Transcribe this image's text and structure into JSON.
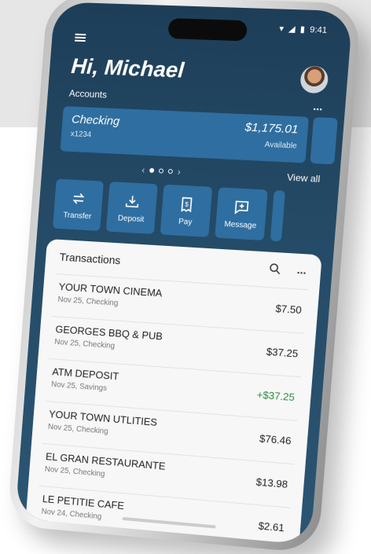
{
  "status": {
    "time": "9:41"
  },
  "header": {
    "greeting": "Hi, Michael"
  },
  "accounts": {
    "label": "Accounts",
    "more": "...",
    "card": {
      "name": "Checking",
      "number": "x1234",
      "balance": "$1,175.01",
      "balance_label": "Available"
    },
    "pager": {
      "prev": "‹",
      "next": "›"
    },
    "view_all": "View all"
  },
  "actions": [
    {
      "label": "Transfer",
      "icon": "transfer-icon"
    },
    {
      "label": "Deposit",
      "icon": "deposit-icon"
    },
    {
      "label": "Pay",
      "icon": "pay-icon"
    },
    {
      "label": "Message",
      "icon": "message-icon"
    }
  ],
  "transactions": {
    "title": "Transactions",
    "more": "...",
    "items": [
      {
        "merchant": "YOUR TOWN CINEMA",
        "meta": "Nov 25, Checking",
        "amount": "$7.50",
        "type": "debit"
      },
      {
        "merchant": "GEORGES BBQ & PUB",
        "meta": "Nov 25, Checking",
        "amount": "$37.25",
        "type": "debit"
      },
      {
        "merchant": "ATM DEPOSIT",
        "meta": "Nov 25, Savings",
        "amount": "+$37.25",
        "type": "credit"
      },
      {
        "merchant": "YOUR TOWN UTLITIES",
        "meta": "Nov 25, Checking",
        "amount": "$76.46",
        "type": "debit"
      },
      {
        "merchant": "EL GRAN RESTAURANTE",
        "meta": "Nov 25, Checking",
        "amount": "$13.98",
        "type": "debit"
      },
      {
        "merchant": "LE PETITIE CAFE",
        "meta": "Nov 24, Checking",
        "amount": "$2.61",
        "type": "debit"
      }
    ]
  },
  "colors": {
    "header_bg": "#244a66",
    "tile": "#2f6ea0",
    "credit": "#2e8b3e"
  }
}
